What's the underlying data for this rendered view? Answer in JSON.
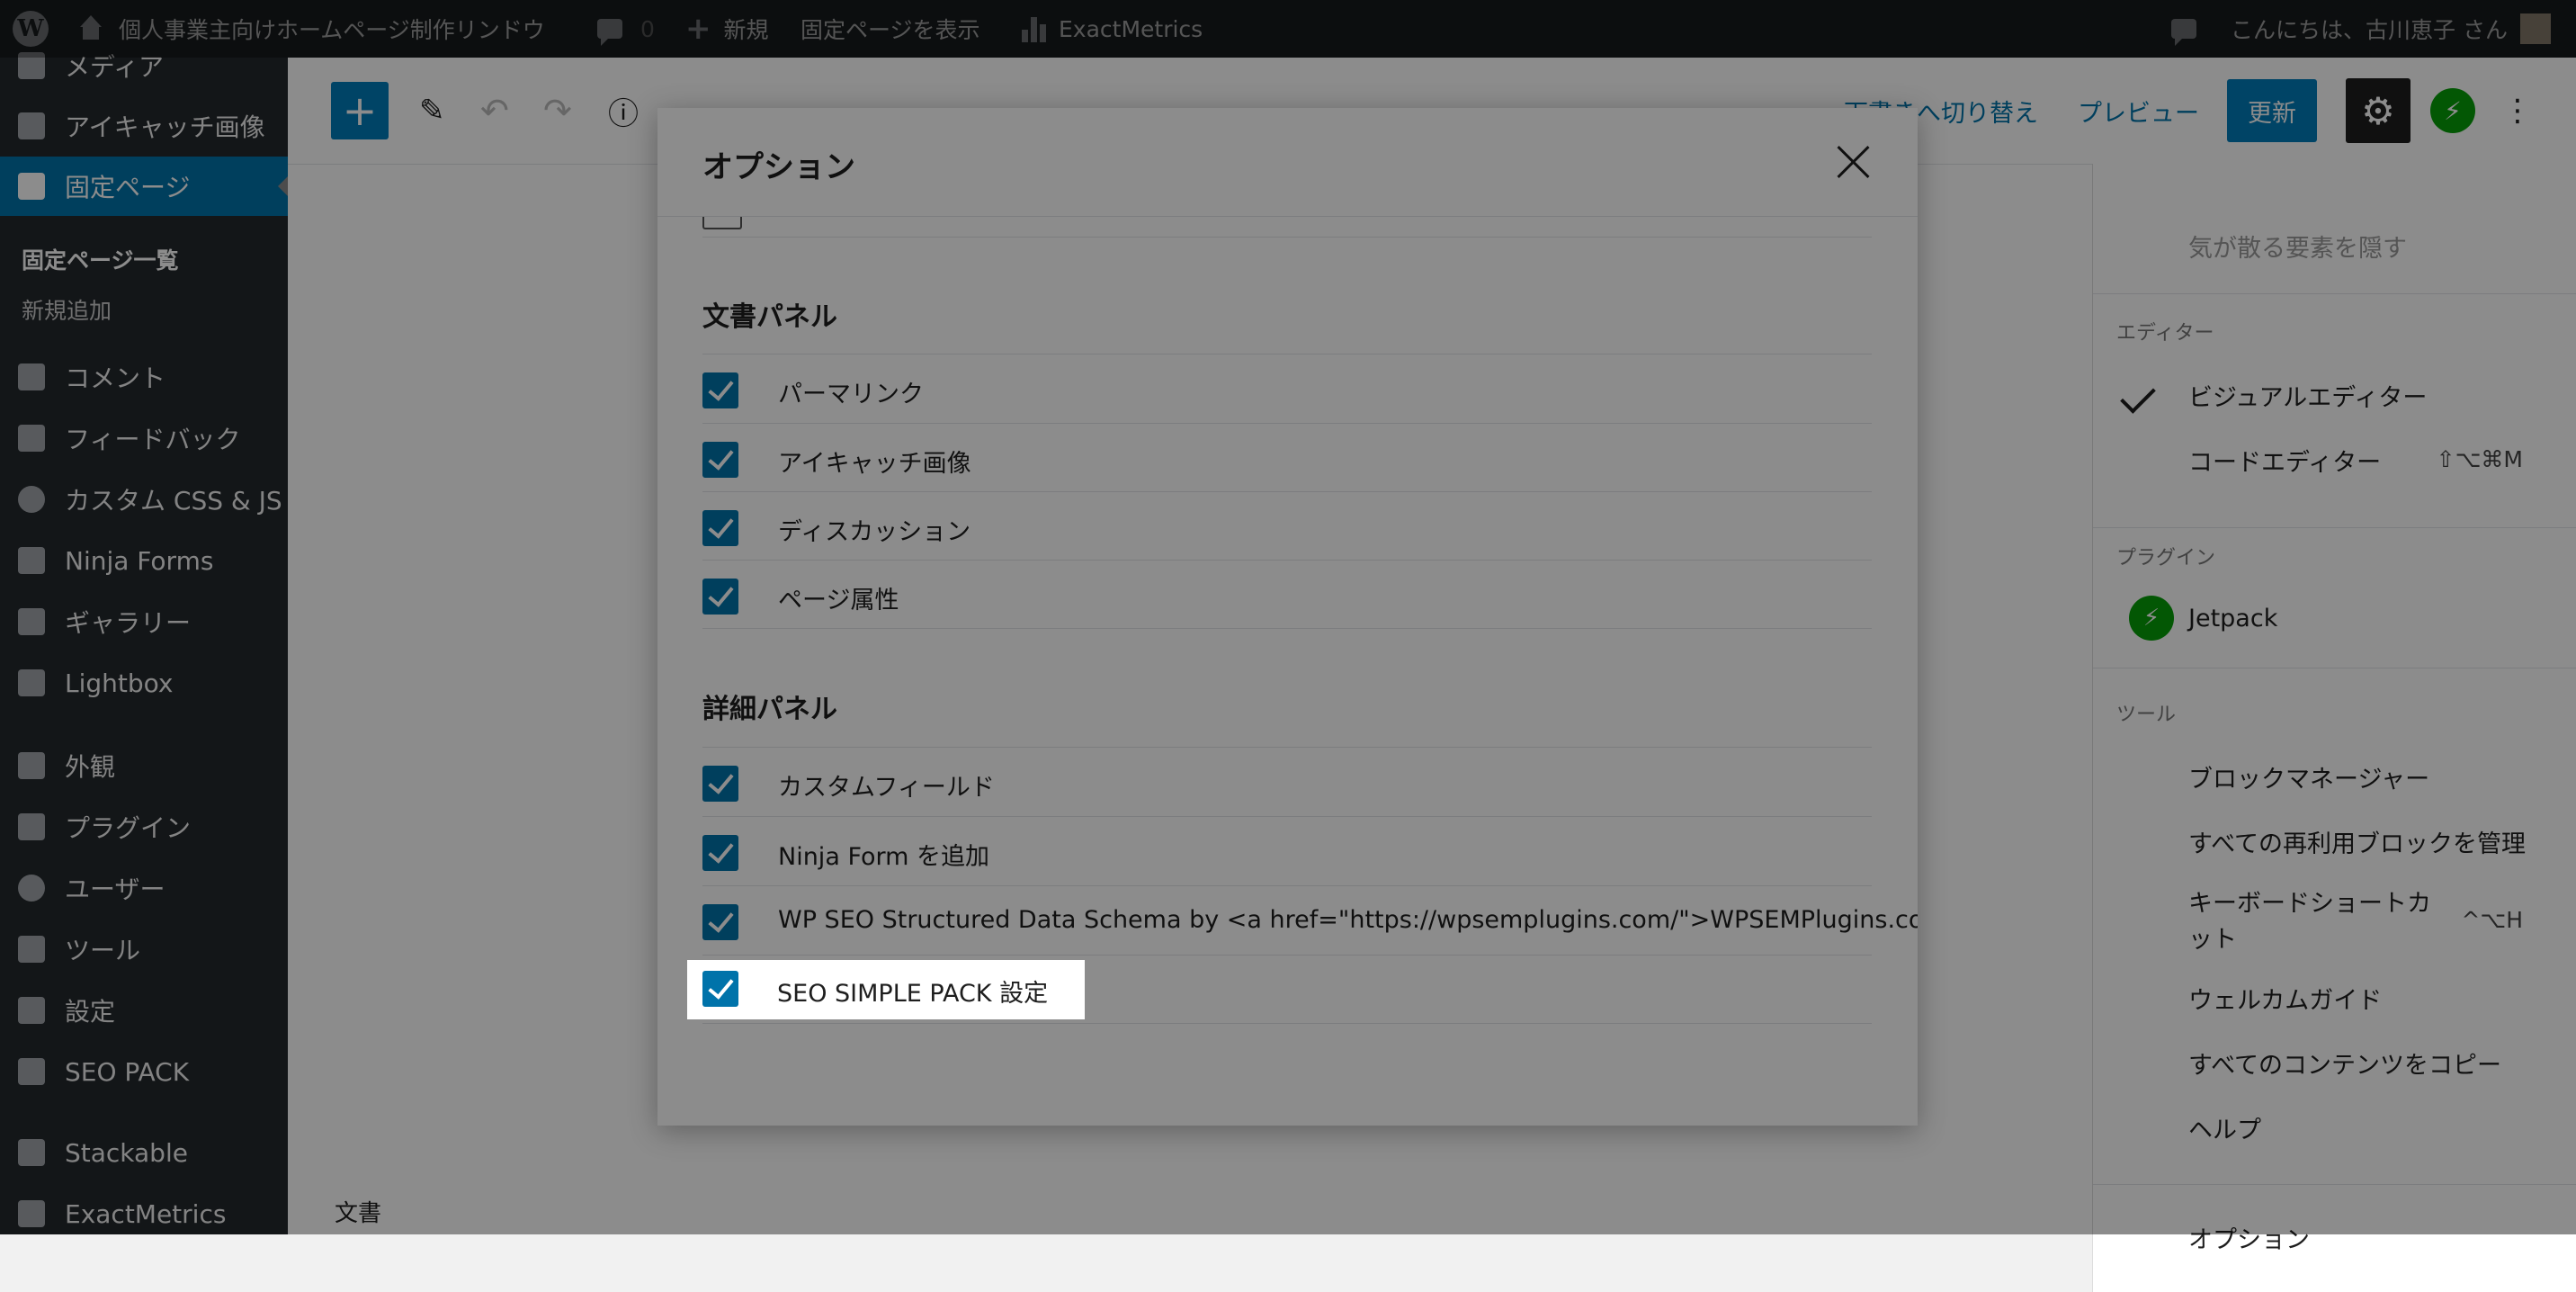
{
  "admin_bar": {
    "site_name": "個人事業主向けホームページ制作リンドウ",
    "comments_count": "0",
    "new_label": "新規",
    "view_page": "固定ページを表示",
    "exactmetrics": "ExactMetrics",
    "greeting": "こんにちは、古川恵子 さん"
  },
  "sidebar": {
    "items": [
      {
        "label": "メディア"
      },
      {
        "label": "アイキャッチ画像"
      },
      {
        "label": "固定ページ"
      },
      {
        "label": "コメント"
      },
      {
        "label": "フィードバック"
      },
      {
        "label": "カスタム CSS & JS"
      },
      {
        "label": "Ninja Forms"
      },
      {
        "label": "ギャラリー"
      },
      {
        "label": "Lightbox"
      },
      {
        "label": "外観"
      },
      {
        "label": "プラグイン"
      },
      {
        "label": "ユーザー"
      },
      {
        "label": "ツール"
      },
      {
        "label": "設定"
      },
      {
        "label": "SEO PACK"
      },
      {
        "label": "Stackable"
      },
      {
        "label": "ExactMetrics"
      }
    ],
    "subitems": [
      {
        "label": "固定ページ一覧"
      },
      {
        "label": "新規追加"
      }
    ]
  },
  "toolbar": {
    "switch_to_draft": "下書きへ切り替え",
    "preview": "プレビュー",
    "update": "更新"
  },
  "content": {
    "document_label": "文書"
  },
  "menu": {
    "distraction": "気が散る要素を隠す",
    "editor_group": "エディター",
    "visual_editor": "ビジュアルエディター",
    "code_editor": "コードエディター",
    "code_editor_shortcut": "⇧⌥⌘M",
    "plugins_group": "プラグイン",
    "jetpack": "Jetpack",
    "tools_group": "ツール",
    "block_manager": "ブロックマネージャー",
    "manage_reusable": "すべての再利用ブロックを管理",
    "keyboard_shortcuts_1": "キーボードショートカ",
    "keyboard_shortcuts_2": "ット",
    "keyboard_shortcuts_shortcut": "^⌥H",
    "welcome_guide": "ウェルカムガイド",
    "copy_all": "すべてのコンテンツをコピー",
    "help": "ヘルプ",
    "options": "オプション"
  },
  "modal": {
    "title": "オプション",
    "sections": [
      {
        "title": "文書パネル",
        "options": [
          {
            "label": "パーマリンク",
            "checked": true
          },
          {
            "label": "アイキャッチ画像",
            "checked": true
          },
          {
            "label": "ディスカッション",
            "checked": true
          },
          {
            "label": "ページ属性",
            "checked": true
          }
        ]
      },
      {
        "title": "詳細パネル",
        "options": [
          {
            "label": "カスタムフィールド",
            "checked": true
          },
          {
            "label": "Ninja Form を追加",
            "checked": true
          },
          {
            "label": "WP SEO Structured Data Schema by <a href=\"https://wpsemplugins.com/\">WPSEMPlugins.com</a>",
            "checked": true
          },
          {
            "label": "SEO SIMPLE PACK 設定",
            "checked": true
          }
        ]
      }
    ]
  }
}
